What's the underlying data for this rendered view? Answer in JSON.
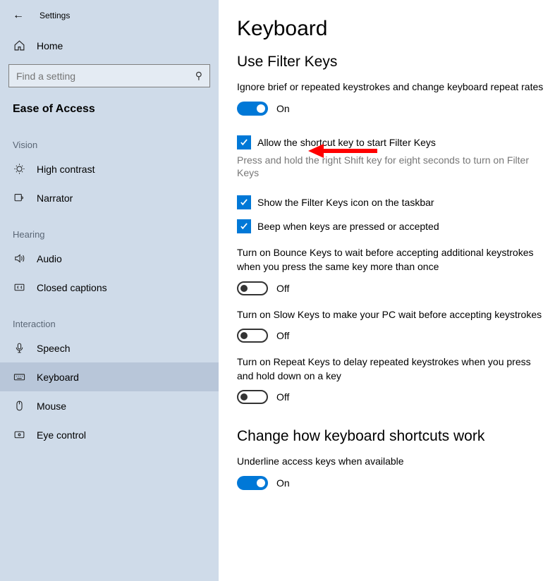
{
  "window": {
    "title": "Settings"
  },
  "sidebar": {
    "home": "Home",
    "search_placeholder": "Find a setting",
    "section": "Ease of Access",
    "categories": {
      "vision": {
        "label": "Vision",
        "items": [
          "High contrast",
          "Narrator"
        ]
      },
      "hearing": {
        "label": "Hearing",
        "items": [
          "Audio",
          "Closed captions"
        ]
      },
      "interaction": {
        "label": "Interaction",
        "items": [
          "Speech",
          "Keyboard",
          "Mouse",
          "Eye control"
        ]
      }
    }
  },
  "main": {
    "title": "Keyboard",
    "filter_keys": {
      "heading": "Use Filter Keys",
      "desc": "Ignore brief or repeated keystrokes and change keyboard repeat rates",
      "toggle_state": "On",
      "shortcut_check": "Allow the shortcut key to start Filter Keys",
      "shortcut_hint": "Press and hold the right Shift key for eight seconds to turn on Filter Keys",
      "icon_check": "Show the Filter Keys icon on the taskbar",
      "beep_check": "Beep when keys are pressed or accepted",
      "bounce_desc": "Turn on Bounce Keys to wait before accepting additional keystrokes when you press the same key more than once",
      "bounce_state": "Off",
      "slow_desc": "Turn on Slow Keys to make your PC wait before accepting keystrokes",
      "slow_state": "Off",
      "repeat_desc": "Turn on Repeat Keys to delay repeated keystrokes when you press and hold down on a key",
      "repeat_state": "Off"
    },
    "shortcuts": {
      "heading": "Change how keyboard shortcuts work",
      "underline_desc": "Underline access keys when available",
      "underline_state": "On"
    }
  }
}
